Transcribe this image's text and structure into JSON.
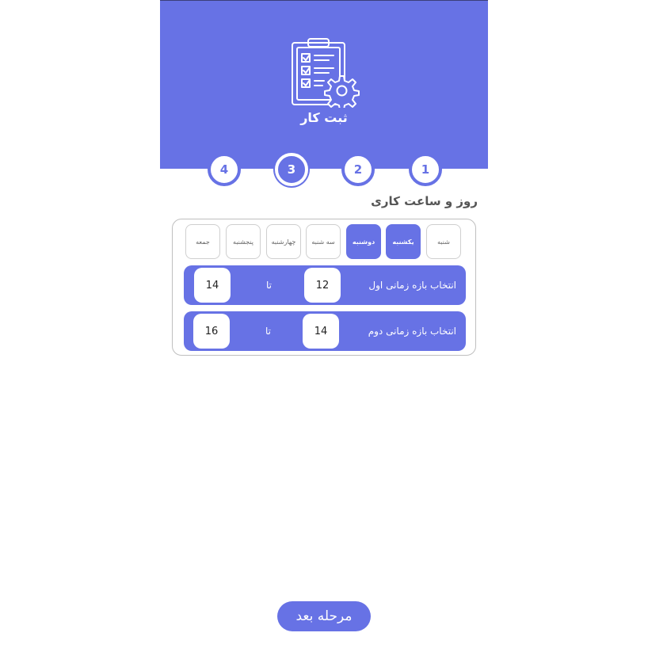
{
  "app": {
    "title": "ثبت کار",
    "icon": "clipboard-gear-icon",
    "accent_color": "#6772e5"
  },
  "steps": {
    "items": [
      {
        "label": "1",
        "active": false
      },
      {
        "label": "2",
        "active": false
      },
      {
        "label": "3",
        "active": true
      },
      {
        "label": "4",
        "active": false
      }
    ]
  },
  "section": {
    "title": "روز و ساعت کاری"
  },
  "days": {
    "items": [
      {
        "label": "شنبه",
        "selected": false
      },
      {
        "label": "یکشنبه",
        "selected": true
      },
      {
        "label": "دوشنبه",
        "selected": true
      },
      {
        "label": "سه شنبه",
        "selected": false
      },
      {
        "label": "چهارشنبه",
        "selected": false
      },
      {
        "label": "پنجشنبه",
        "selected": false
      },
      {
        "label": "جمعه",
        "selected": false
      }
    ]
  },
  "ranges": [
    {
      "label": "انتخاب بازه زمانی اول",
      "from": "12",
      "to_label": "تا",
      "to": "14"
    },
    {
      "label": "انتخاب بازه زمانی دوم",
      "from": "14",
      "to_label": "تا",
      "to": "16"
    }
  ],
  "footer": {
    "next_label": "مرحله بعد"
  }
}
